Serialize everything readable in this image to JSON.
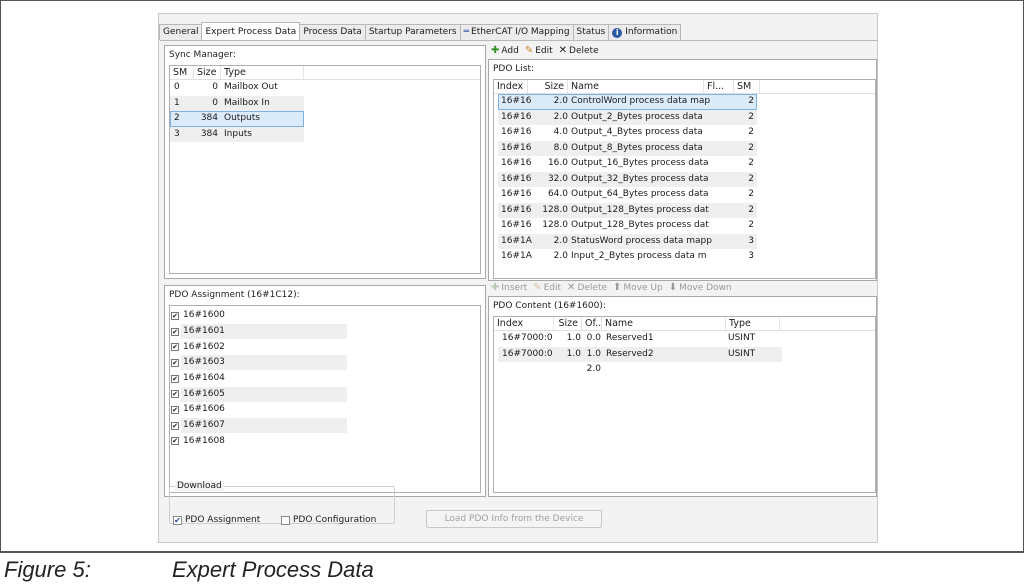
{
  "tabs": [
    {
      "label": "General",
      "icon": ""
    },
    {
      "label": "Expert Process Data",
      "icon": "",
      "active": true
    },
    {
      "label": "Process Data",
      "icon": ""
    },
    {
      "label": "Startup Parameters",
      "icon": ""
    },
    {
      "label": "EtherCAT I/O Mapping",
      "icon": "ethercat-icon"
    },
    {
      "label": "Status",
      "icon": ""
    },
    {
      "label": "Information",
      "icon": "info-icon"
    }
  ],
  "sync_manager": {
    "title": "Sync Manager:",
    "columns": [
      "SM",
      "Size",
      "Type"
    ],
    "rows": [
      {
        "sm": "0",
        "size": "0",
        "type": "Mailbox Out"
      },
      {
        "sm": "1",
        "size": "0",
        "type": "Mailbox In"
      },
      {
        "sm": "2",
        "size": "384",
        "type": "Outputs",
        "selected": true
      },
      {
        "sm": "3",
        "size": "384",
        "type": "Inputs"
      }
    ]
  },
  "pdo_toolbar": {
    "add": "Add",
    "edit": "Edit",
    "delete": "Delete"
  },
  "pdo_list": {
    "title": "PDO List:",
    "columns": [
      "Index",
      "Size",
      "Name",
      "Fl...",
      "SM"
    ],
    "rows": [
      {
        "index": "16#16",
        "size": "2.0",
        "name": "ControlWord process data map",
        "flags": "",
        "sm": "2",
        "selected": true
      },
      {
        "index": "16#16",
        "size": "2.0",
        "name": "Output_2_Bytes process data",
        "flags": "",
        "sm": "2"
      },
      {
        "index": "16#16",
        "size": "4.0",
        "name": "Output_4_Bytes process data",
        "flags": "",
        "sm": "2"
      },
      {
        "index": "16#16",
        "size": "8.0",
        "name": "Output_8_Bytes process data",
        "flags": "",
        "sm": "2"
      },
      {
        "index": "16#16",
        "size": "16.0",
        "name": "Output_16_Bytes process data",
        "flags": "",
        "sm": "2"
      },
      {
        "index": "16#16",
        "size": "32.0",
        "name": "Output_32_Bytes process data",
        "flags": "",
        "sm": "2"
      },
      {
        "index": "16#16",
        "size": "64.0",
        "name": "Output_64_Bytes process data",
        "flags": "",
        "sm": "2"
      },
      {
        "index": "16#16",
        "size": "128.0",
        "name": "Output_128_Bytes process dat",
        "flags": "",
        "sm": "2"
      },
      {
        "index": "16#16",
        "size": "128.0",
        "name": "Output_128_Bytes process dat",
        "flags": "",
        "sm": "2"
      },
      {
        "index": "16#1A",
        "size": "2.0",
        "name": "StatusWord process data mapp",
        "flags": "",
        "sm": "3"
      },
      {
        "index": "16#1A",
        "size": "2.0",
        "name": "Input_2_Bytes process data m",
        "flags": "",
        "sm": "3"
      }
    ]
  },
  "pdo_assignment": {
    "title": "PDO Assignment (16#1C12):",
    "items": [
      {
        "label": "16#1600",
        "checked": true
      },
      {
        "label": "16#1601",
        "checked": true
      },
      {
        "label": "16#1602",
        "checked": true
      },
      {
        "label": "16#1603",
        "checked": true
      },
      {
        "label": "16#1604",
        "checked": true
      },
      {
        "label": "16#1605",
        "checked": true
      },
      {
        "label": "16#1606",
        "checked": true
      },
      {
        "label": "16#1607",
        "checked": true
      },
      {
        "label": "16#1608",
        "checked": true
      }
    ]
  },
  "content_toolbar": {
    "insert": "Insert",
    "edit": "Edit",
    "delete": "Delete",
    "move_up": "Move Up",
    "move_down": "Move Down"
  },
  "pdo_content": {
    "title": "PDO Content (16#1600):",
    "columns": [
      "Index",
      "Size",
      "Of...",
      "Name",
      "Type"
    ],
    "rows": [
      {
        "index": "16#7000:0",
        "size": "1.0",
        "offset": "0.0",
        "name": "Reserved1",
        "type": "USINT"
      },
      {
        "index": "16#7000:0",
        "size": "1.0",
        "offset": "1.0",
        "name": "Reserved2",
        "type": "USINT"
      },
      {
        "index": "",
        "size": "",
        "offset": "2.0",
        "name": "",
        "type": ""
      }
    ]
  },
  "download": {
    "title": "Download",
    "pdo_assignment_label": "PDO Assignment",
    "pdo_assignment_checked": true,
    "pdo_configuration_label": "PDO Configuration",
    "pdo_configuration_checked": false
  },
  "load_button": "Load PDO Info from the Device",
  "caption": {
    "number": "Figure 5:",
    "text": "Expert Process Data"
  },
  "colors": {
    "selection": "#dcebfa",
    "selection_border": "#7fb2e4",
    "alt_row": "#efefef",
    "info_icon": "#2d5aa8"
  }
}
